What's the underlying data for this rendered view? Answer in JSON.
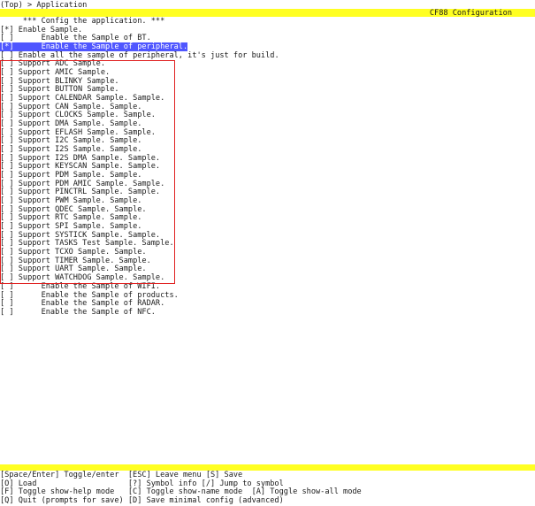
{
  "breadcrumb": "(Top) > Application",
  "header": {
    "title": "CF88 Configuration"
  },
  "comment_line": "*** Config the application. ***",
  "menu": [
    {
      "box": "[*]",
      "label": "Enable Sample.",
      "indent": 0
    },
    {
      "box": "[ ]",
      "label": "Enable the Sample of BT.",
      "indent": 1
    },
    {
      "box": "[*]",
      "label": "Enable the Sample of peripheral.",
      "indent": 1,
      "selected": true
    },
    {
      "box": "[ ]",
      "label": "Enable all the sample of peripheral, it's just for build.",
      "indent": 0
    },
    {
      "box": "[ ]",
      "label": "Support ADC Sample.",
      "indent": 0
    },
    {
      "box": "[ ]",
      "label": "Support AMIC Sample.",
      "indent": 0
    },
    {
      "box": "[ ]",
      "label": "Support BLINKY Sample.",
      "indent": 0
    },
    {
      "box": "[ ]",
      "label": "Support BUTTON Sample.",
      "indent": 0
    },
    {
      "box": "[ ]",
      "label": "Support CALENDAR Sample. Sample.",
      "indent": 0
    },
    {
      "box": "[ ]",
      "label": "Support CAN Sample. Sample.",
      "indent": 0
    },
    {
      "box": "[ ]",
      "label": "Support CLOCKS Sample. Sample.",
      "indent": 0
    },
    {
      "box": "[ ]",
      "label": "Support DMA Sample. Sample.",
      "indent": 0
    },
    {
      "box": "[ ]",
      "label": "Support EFLASH Sample. Sample.",
      "indent": 0
    },
    {
      "box": "[ ]",
      "label": "Support I2C Sample. Sample.",
      "indent": 0
    },
    {
      "box": "[ ]",
      "label": "Support I2S Sample. Sample.",
      "indent": 0
    },
    {
      "box": "[ ]",
      "label": "Support I2S DMA Sample. Sample.",
      "indent": 0
    },
    {
      "box": "[ ]",
      "label": "Support KEYSCAN Sample. Sample.",
      "indent": 0
    },
    {
      "box": "[ ]",
      "label": "Support PDM Sample. Sample.",
      "indent": 0
    },
    {
      "box": "[ ]",
      "label": "Support PDM AMIC Sample. Sample.",
      "indent": 0
    },
    {
      "box": "[ ]",
      "label": "Support PINCTRL Sample. Sample.",
      "indent": 0
    },
    {
      "box": "[ ]",
      "label": "Support PWM Sample. Sample.",
      "indent": 0
    },
    {
      "box": "[ ]",
      "label": "Support QDEC Sample. Sample.",
      "indent": 0
    },
    {
      "box": "[ ]",
      "label": "Support RTC Sample. Sample.",
      "indent": 0
    },
    {
      "box": "[ ]",
      "label": "Support SPI Sample. Sample.",
      "indent": 0
    },
    {
      "box": "[ ]",
      "label": "Support SYSTICK Sample. Sample.",
      "indent": 0
    },
    {
      "box": "[ ]",
      "label": "Support TASKS Test Sample. Sample.",
      "indent": 0
    },
    {
      "box": "[ ]",
      "label": "Support TCXO Sample. Sample.",
      "indent": 0
    },
    {
      "box": "[ ]",
      "label": "Support TIMER Sample. Sample.",
      "indent": 0
    },
    {
      "box": "[ ]",
      "label": "Support UART Sample. Sample.",
      "indent": 0
    },
    {
      "box": "[ ]",
      "label": "Support WATCHDOG Sample. Sample.",
      "indent": 0
    },
    {
      "box": "[ ]",
      "label": "Enable the Sample of WIFI.",
      "indent": 1
    },
    {
      "box": "[ ]",
      "label": "Enable the Sample of products.",
      "indent": 1
    },
    {
      "box": "[ ]",
      "label": "Enable the Sample of RADAR.",
      "indent": 1
    },
    {
      "box": "[ ]",
      "label": "Enable the Sample of NFC.",
      "indent": 1
    }
  ],
  "help": [
    "[Space/Enter] Toggle/enter  [ESC] Leave menu [S] Save",
    "[O] Load                    [?] Symbol info [/] Jump to symbol",
    "[F] Toggle show-help mode   [C] Toggle show-name mode  [A] Toggle show-all mode",
    "[Q] Quit (prompts for save) [D] Save minimal config (advanced)"
  ],
  "colors": {
    "title_bar": "#ffff22",
    "selection": "#4f56ff",
    "annotation_frame": "#e02020"
  }
}
